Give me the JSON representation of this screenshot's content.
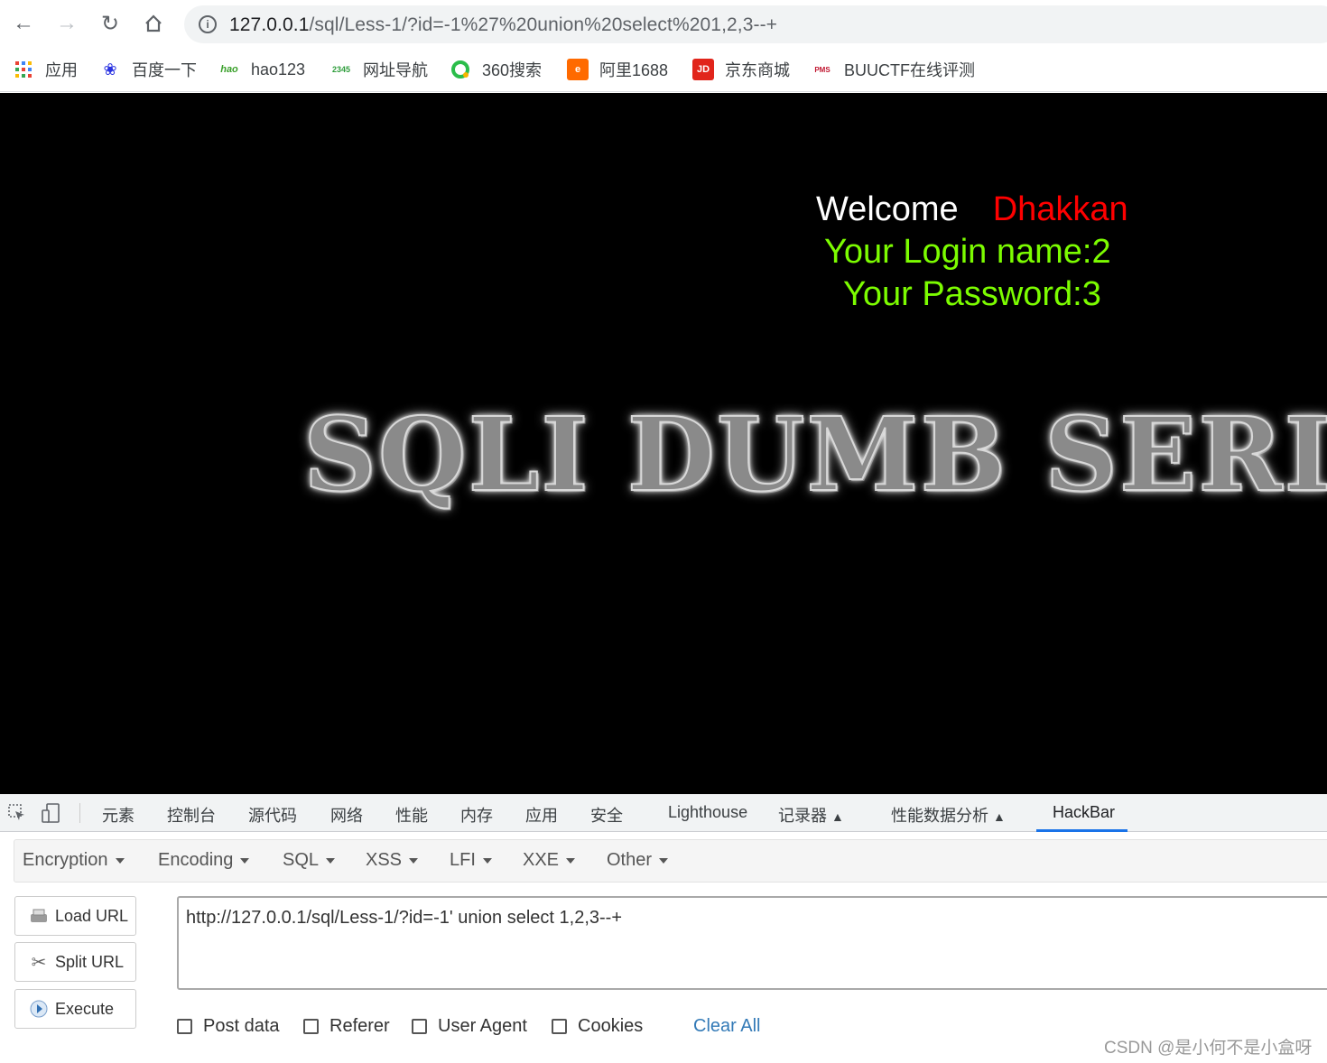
{
  "browser": {
    "url_host": "127.0.0.1",
    "url_rest": "/sql/Less-1/?id=-1%27%20union%20select%201,2,3--+"
  },
  "bookmarks": [
    {
      "label": "应用",
      "icon": "apps-grid-icon"
    },
    {
      "label": "百度一下",
      "icon": "baidu-paw-icon"
    },
    {
      "label": "hao123",
      "icon": "hao123-icon"
    },
    {
      "label": "网址导航",
      "icon": "2345-icon"
    },
    {
      "label": "360搜索",
      "icon": "360-icon"
    },
    {
      "label": "阿里1688",
      "icon": "ali1688-icon"
    },
    {
      "label": "京东商城",
      "icon": "jd-icon"
    },
    {
      "label": "BUUCTF在线评测",
      "icon": "buuctf-icon"
    }
  ],
  "page": {
    "welcome": "Welcome",
    "user": "Dhakkan",
    "login_name": "Your Login name:2",
    "password": "Your Password:3",
    "banner": "SQLI DUMB SERIES"
  },
  "devtools": {
    "tabs": [
      "元素",
      "控制台",
      "源代码",
      "网络",
      "性能",
      "内存",
      "应用",
      "安全",
      "Lighthouse",
      "记录器",
      "性能数据分析",
      "HackBar"
    ],
    "active_tab": "HackBar"
  },
  "hackbar": {
    "menu": [
      "Encryption",
      "Encoding",
      "SQL",
      "XSS",
      "LFI",
      "XXE",
      "Other"
    ],
    "buttons": {
      "load": "Load URL",
      "split": "Split URL",
      "execute": "Execute"
    },
    "url_value": "http://127.0.0.1/sql/Less-1/?id=-1' union select 1,2,3--+",
    "checkboxes": [
      "Post data",
      "Referer",
      "User Agent",
      "Cookies"
    ],
    "clear_all": "Clear All"
  },
  "watermark": "CSDN @是小何不是小盒呀",
  "colors": {
    "user": "#ff0000",
    "info": "#7cfc00",
    "link": "#337ab7",
    "tab_underline": "#1a73e8"
  }
}
